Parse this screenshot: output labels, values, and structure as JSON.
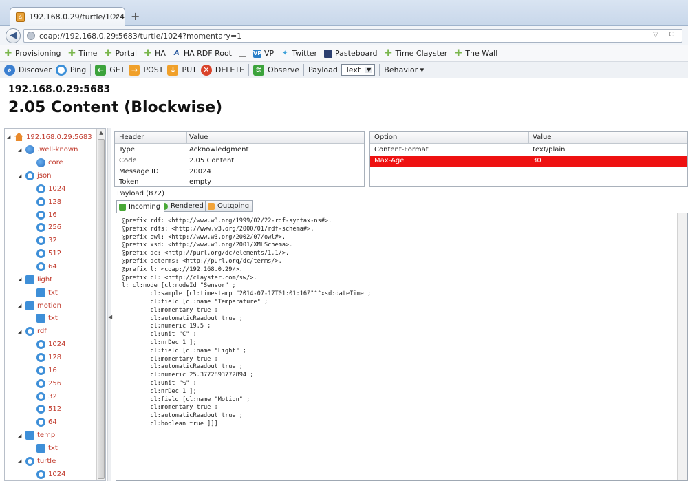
{
  "browser": {
    "tab_title": "192.168.0.29/turtle/1024",
    "tab_close": "×",
    "new_tab": "+",
    "url": "coap://192.168.0.29:5683/turtle/1024?momentary=1",
    "url_right": "▽ C"
  },
  "bookmarks": [
    {
      "label": "Provisioning",
      "icon": "plus-icon"
    },
    {
      "label": "Time",
      "icon": "plus-icon"
    },
    {
      "label": "Portal",
      "icon": "plus-icon"
    },
    {
      "label": "HA",
      "icon": "plus-icon"
    },
    {
      "label": "HA RDF Root",
      "icon": "a-icon"
    },
    {
      "label": "",
      "icon": "dashed-square-icon"
    },
    {
      "label": "VP",
      "icon": "vp-icon"
    },
    {
      "label": "Twitter",
      "icon": "twitter-icon"
    },
    {
      "label": "Pasteboard",
      "icon": "pasteboard-icon"
    },
    {
      "label": "Time Clayster",
      "icon": "plus-icon"
    },
    {
      "label": "The Wall",
      "icon": "plus-icon"
    }
  ],
  "toolbar": {
    "discover": "Discover",
    "ping": "Ping",
    "get": "GET",
    "post": "POST",
    "put": "PUT",
    "delete": "DELETE",
    "observe": "Observe",
    "payload": "Payload",
    "payload_type": "Text",
    "behavior": "Behavior ▾"
  },
  "host": "192.168.0.29:5683",
  "status_title": "2.05 Content (Blockwise)",
  "tree": [
    {
      "label": "192.168.0.29:5683",
      "icon": "home-icon",
      "depth": 0,
      "toggle": "◢"
    },
    {
      "label": ".well-known",
      "icon": "globe-icon",
      "depth": 1,
      "toggle": "◢"
    },
    {
      "label": "core",
      "icon": "globe-icon",
      "depth": 2,
      "toggle": ""
    },
    {
      "label": "json",
      "icon": "resource-icon",
      "depth": 1,
      "toggle": "◢"
    },
    {
      "label": "1024",
      "icon": "resource-icon",
      "depth": 2,
      "toggle": ""
    },
    {
      "label": "128",
      "icon": "resource-icon",
      "depth": 2,
      "toggle": ""
    },
    {
      "label": "16",
      "icon": "resource-icon",
      "depth": 2,
      "toggle": ""
    },
    {
      "label": "256",
      "icon": "resource-icon",
      "depth": 2,
      "toggle": ""
    },
    {
      "label": "32",
      "icon": "resource-icon",
      "depth": 2,
      "toggle": ""
    },
    {
      "label": "512",
      "icon": "resource-icon",
      "depth": 2,
      "toggle": ""
    },
    {
      "label": "64",
      "icon": "resource-icon",
      "depth": 2,
      "toggle": ""
    },
    {
      "label": "light",
      "icon": "feed-icon",
      "depth": 1,
      "toggle": "◢"
    },
    {
      "label": "txt",
      "icon": "feed-icon",
      "depth": 2,
      "toggle": ""
    },
    {
      "label": "motion",
      "icon": "feed-icon",
      "depth": 1,
      "toggle": "◢"
    },
    {
      "label": "txt",
      "icon": "feed-icon",
      "depth": 2,
      "toggle": ""
    },
    {
      "label": "rdf",
      "icon": "resource-icon",
      "depth": 1,
      "toggle": "◢"
    },
    {
      "label": "1024",
      "icon": "resource-icon",
      "depth": 2,
      "toggle": ""
    },
    {
      "label": "128",
      "icon": "resource-icon",
      "depth": 2,
      "toggle": ""
    },
    {
      "label": "16",
      "icon": "resource-icon",
      "depth": 2,
      "toggle": ""
    },
    {
      "label": "256",
      "icon": "resource-icon",
      "depth": 2,
      "toggle": ""
    },
    {
      "label": "32",
      "icon": "resource-icon",
      "depth": 2,
      "toggle": ""
    },
    {
      "label": "512",
      "icon": "resource-icon",
      "depth": 2,
      "toggle": ""
    },
    {
      "label": "64",
      "icon": "resource-icon",
      "depth": 2,
      "toggle": ""
    },
    {
      "label": "temp",
      "icon": "feed-icon",
      "depth": 1,
      "toggle": "◢"
    },
    {
      "label": "txt",
      "icon": "feed-icon",
      "depth": 2,
      "toggle": ""
    },
    {
      "label": "turtle",
      "icon": "resource-icon",
      "depth": 1,
      "toggle": "◢"
    },
    {
      "label": "1024",
      "icon": "resource-icon",
      "depth": 2,
      "toggle": ""
    }
  ],
  "headers_table": {
    "col_header": "Header",
    "col_value": "Value",
    "rows": [
      {
        "name": "Type",
        "value": "Acknowledgment"
      },
      {
        "name": "Code",
        "value": "2.05 Content"
      },
      {
        "name": "Message ID",
        "value": "20024"
      },
      {
        "name": "Token",
        "value": "empty"
      }
    ]
  },
  "options_table": {
    "col_option": "Option",
    "col_value": "Value",
    "rows": [
      {
        "name": "Content-Format",
        "value": "text/plain",
        "highlight": false
      },
      {
        "name": "Max-Age",
        "value": "30",
        "highlight": true
      }
    ],
    "highlight_color": "#ee1111"
  },
  "payload": {
    "label": "Payload (872)",
    "tabs": [
      "Incoming",
      "Rendered",
      "Outgoing"
    ],
    "active_tab": "Incoming",
    "content": "@prefix rdf: <http://www.w3.org/1999/02/22-rdf-syntax-ns#>.\n@prefix rdfs: <http://www.w3.org/2000/01/rdf-schema#>.\n@prefix owl: <http://www.w3.org/2002/07/owl#>.\n@prefix xsd: <http://www.w3.org/2001/XMLSchema>.\n@prefix dc: <http://purl.org/dc/elements/1.1/>.\n@prefix dcterms: <http://purl.org/dc/terms/>.\n@prefix l: <coap://192.168.0.29/>.\n@prefix cl: <http://clayster.com/sw/>.\nl: cl:node [cl:nodeId \"Sensor\" ;\n        cl:sample [cl:timestamp \"2014-07-17T01:01:16Z\"^^xsd:dateTime ;\n        cl:field [cl:name \"Temperature\" ;\n        cl:momentary true ;\n        cl:automaticReadout true ;\n        cl:numeric 19.5 ;\n        cl:unit \"C\" ;\n        cl:nrDec 1 ];\n        cl:field [cl:name \"Light\" ;\n        cl:momentary true ;\n        cl:automaticReadout true ;\n        cl:numeric 25.3772893772894 ;\n        cl:unit \"%\" ;\n        cl:nrDec 1 ];\n        cl:field [cl:name \"Motion\" ;\n        cl:momentary true ;\n        cl:automaticReadout true ;\n        cl:boolean true ]]]"
  }
}
